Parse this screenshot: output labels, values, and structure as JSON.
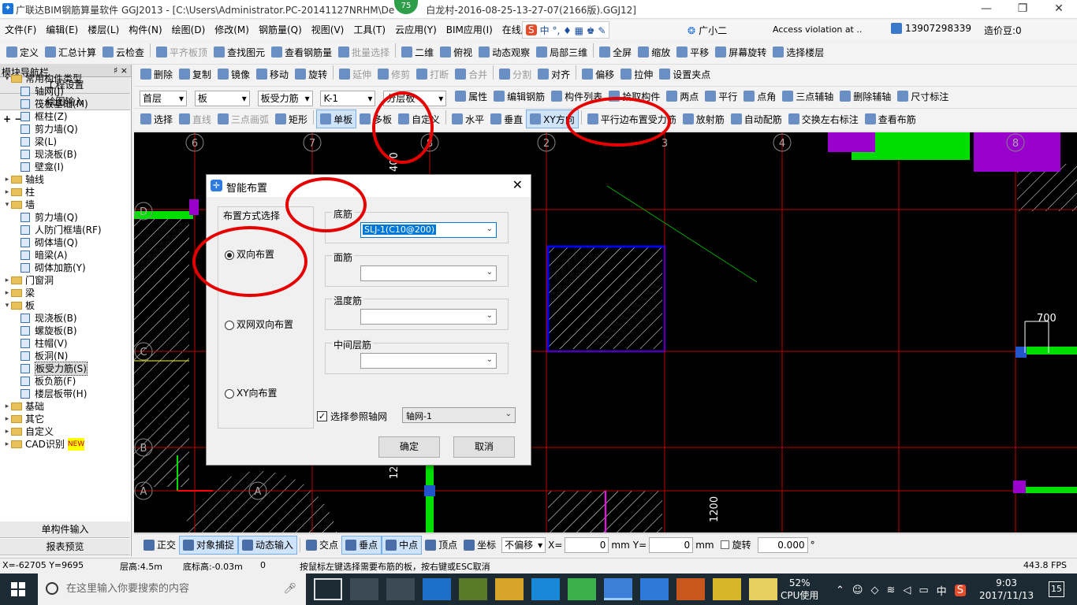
{
  "titlebar": {
    "title": "广联达BIM钢筋算量软件 GGJ2013 - [C:\\Users\\Administrator.PC-20141127NRHM\\De",
    "title_tail": "白龙村-2016-08-25-13-27-07(2166版).GGJ12]",
    "badge": "75",
    "min": "—",
    "max": "❐",
    "close": "✕"
  },
  "menu": [
    "文件(F)",
    "编辑(E)",
    "楼层(L)",
    "构件(N)",
    "绘图(D)",
    "修改(M)",
    "钢筋量(Q)",
    "视图(V)",
    "工具(T)",
    "云应用(Y)",
    "BIM应用(I)",
    "在线服务(S"
  ],
  "menu_right": {
    "ime": "中 °, ♦ ▦ ♚ ✎",
    "ime_text": "广小二",
    "access": "Access violation at ..",
    "phone": "13907298339",
    "credit": "造价豆:0"
  },
  "toolbar1": [
    "定义",
    "汇总计算",
    "云检查",
    "平齐板顶",
    "查找图元",
    "查看钢筋量",
    "批量选择",
    "二维",
    "俯视",
    "动态观察",
    "局部三维",
    "全屏",
    "缩放",
    "平移",
    "屏幕旋转",
    "选择楼层"
  ],
  "toolbar2": [
    "删除",
    "复制",
    "镜像",
    "移动",
    "旋转",
    "延伸",
    "修剪",
    "打断",
    "合并",
    "分割",
    "对齐",
    "偏移",
    "拉伸",
    "设置夹点"
  ],
  "toolbar3": {
    "floor": "首层",
    "type": "板",
    "sub": "板受力筋",
    "name": "K-1",
    "layer": "分层板",
    "items": [
      "属性",
      "编辑钢筋",
      "构件列表",
      "拾取构件",
      "两点",
      "平行",
      "点角",
      "三点辅轴",
      "删除辅轴",
      "尺寸标注"
    ]
  },
  "toolbar4": [
    "选择",
    "直线",
    "三点画弧",
    "矩形",
    "单板",
    "多板",
    "自定义",
    "水平",
    "垂直",
    "XY方向",
    "平行边布置受力筋",
    "放射筋",
    "自动配筋",
    "交换左右标注",
    "查看布筋"
  ],
  "leftpane": {
    "title": "模块导航栏",
    "pin": "♯ ×",
    "btn_project": "工程设置",
    "btn_draw": "绘图输入",
    "btn_single": "单构件输入",
    "btn_report": "报表预览"
  },
  "tree": [
    {
      "label": "常用构件类型",
      "level": 0,
      "folder": true,
      "exp": "▾"
    },
    {
      "label": "轴网(J)",
      "level": 1
    },
    {
      "label": "筏板基础(M)",
      "level": 1
    },
    {
      "label": "框柱(Z)",
      "level": 1
    },
    {
      "label": "剪力墙(Q)",
      "level": 1
    },
    {
      "label": "梁(L)",
      "level": 1
    },
    {
      "label": "现浇板(B)",
      "level": 1
    },
    {
      "label": "壁龛(I)",
      "level": 1
    },
    {
      "label": "轴线",
      "level": 0,
      "folder": true,
      "exp": "▸"
    },
    {
      "label": "柱",
      "level": 0,
      "folder": true,
      "exp": "▸"
    },
    {
      "label": "墙",
      "level": 0,
      "folder": true,
      "exp": "▾"
    },
    {
      "label": "剪力墙(Q)",
      "level": 1
    },
    {
      "label": "人防门框墙(RF)",
      "level": 1
    },
    {
      "label": "砌体墙(Q)",
      "level": 1
    },
    {
      "label": "暗梁(A)",
      "level": 1
    },
    {
      "label": "砌体加筋(Y)",
      "level": 1
    },
    {
      "label": "门窗洞",
      "level": 0,
      "folder": true,
      "exp": "▸"
    },
    {
      "label": "梁",
      "level": 0,
      "folder": true,
      "exp": "▸"
    },
    {
      "label": "板",
      "level": 0,
      "folder": true,
      "exp": "▾"
    },
    {
      "label": "现浇板(B)",
      "level": 1
    },
    {
      "label": "螺旋板(B)",
      "level": 1
    },
    {
      "label": "柱帽(V)",
      "level": 1
    },
    {
      "label": "板洞(N)",
      "level": 1
    },
    {
      "label": "板受力筋(S)",
      "level": 1,
      "selected": true
    },
    {
      "label": "板负筋(F)",
      "level": 1
    },
    {
      "label": "楼层板带(H)",
      "level": 1
    },
    {
      "label": "基础",
      "level": 0,
      "folder": true,
      "exp": "▸"
    },
    {
      "label": "其它",
      "level": 0,
      "folder": true,
      "exp": "▸"
    },
    {
      "label": "自定义",
      "level": 0,
      "folder": true,
      "exp": "▸"
    },
    {
      "label": "CAD识别",
      "level": 0,
      "folder": true,
      "exp": "▸",
      "new": "NEW"
    }
  ],
  "canvas": {
    "axes_top": [
      "6",
      "7",
      "8",
      "2",
      "3",
      "4",
      "8"
    ],
    "axes_left": [
      "D",
      "C",
      "B",
      "A"
    ],
    "dims": [
      "400",
      "700",
      "1200",
      "12"
    ],
    "axis_a": "A"
  },
  "dialog": {
    "title": "智能布置",
    "close": "✕",
    "group_mode": "布置方式选择",
    "opt1": "双向布置",
    "opt2": "双网双向布置",
    "opt3": "XY向布置",
    "bottom_label": "底筋",
    "bottom_value": "SLJ-1(C10@200)",
    "top_label": "面筋",
    "top_value": "",
    "temp_label": "温度筋",
    "temp_value": "",
    "mid_label": "中间层筋",
    "mid_value": "",
    "checkbox_label": "选择参照轴网",
    "grid_value": "轴网-1",
    "ok": "确定",
    "cancel": "取消"
  },
  "snapbar": {
    "items": [
      "正交",
      "对象捕捉",
      "动态输入",
      "交点",
      "垂点",
      "中点",
      "顶点",
      "坐标"
    ],
    "offset": "不偏移",
    "x_label": "X=",
    "x_val": "0",
    "unit_mm": "mm",
    "y_label": "Y=",
    "y_val": "0",
    "unit_mm2": "mm",
    "rotate": "旋转",
    "rot_val": "0.000",
    "deg": "°"
  },
  "status": {
    "coord": "X=-62705 Y=9695",
    "floor_h": "层高:4.5m",
    "base_h": "底标高:-0.03m",
    "zero": "0",
    "hint": "按鼠标左键选择需要布筋的板，按右键或ESC取消",
    "fps": "443.8 FPS"
  },
  "taskbar": {
    "search": "在这里输入你要搜索的内容",
    "cpu_pct": "52%",
    "cpu_label": "CPU使用",
    "ime": "中",
    "time": "9:03",
    "date": "2017/11/13",
    "notif": "15"
  },
  "colors": {
    "grid": "#c00000",
    "green": "#00dd00",
    "purple": "#9900cc",
    "blue": "#0000ee",
    "circle": "#e60000"
  }
}
